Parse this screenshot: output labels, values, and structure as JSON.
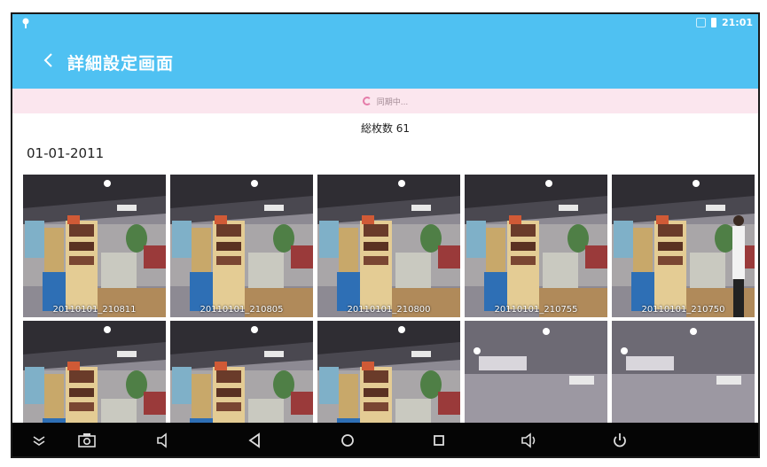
{
  "status_bar": {
    "time": "21:01"
  },
  "app_bar": {
    "title": "詳細設定画面"
  },
  "sync_bar": {
    "text": "同期中..."
  },
  "summary": {
    "total_label": "総枚数 61"
  },
  "section": {
    "date": "01-01-2011"
  },
  "photos": [
    {
      "caption": "20110101_210811",
      "kind": "store"
    },
    {
      "caption": "20110101_210805",
      "kind": "store"
    },
    {
      "caption": "20110101_210800",
      "kind": "store"
    },
    {
      "caption": "20110101_210755",
      "kind": "store"
    },
    {
      "caption": "20110101_210750",
      "kind": "store-person"
    },
    {
      "caption": "",
      "kind": "store"
    },
    {
      "caption": "",
      "kind": "store"
    },
    {
      "caption": "",
      "kind": "store"
    },
    {
      "caption": "",
      "kind": "ceiling"
    },
    {
      "caption": "",
      "kind": "ceiling"
    }
  ],
  "nav_bar": {
    "icons": [
      "collapse-icon",
      "screenshot-icon",
      "volume-down-icon",
      "back-icon",
      "home-icon",
      "recents-icon",
      "volume-up-icon",
      "power-icon"
    ]
  },
  "colors": {
    "accent": "#4fc1f2",
    "sync_bg": "#fbe6ee",
    "nav_bg": "#050505"
  }
}
